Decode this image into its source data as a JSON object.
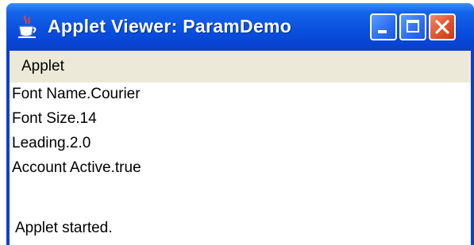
{
  "window": {
    "title": "Applet Viewer: ParamDemo",
    "title_icon": "java-cup-icon",
    "controls": {
      "minimize_icon": "minimize-icon",
      "maximize_icon": "maximize-icon",
      "close_icon": "close-icon"
    }
  },
  "menubar": {
    "items": [
      {
        "label": "Applet"
      }
    ]
  },
  "applet": {
    "lines": [
      "Font Name.Courier",
      "Font Size.14",
      "Leading.2.0",
      "Account Active.true"
    ]
  },
  "status": {
    "text": "Applet started."
  },
  "colors": {
    "titlebar": "#0a50df",
    "menubar": "#ece9d8",
    "close_button": "#e2522a"
  }
}
